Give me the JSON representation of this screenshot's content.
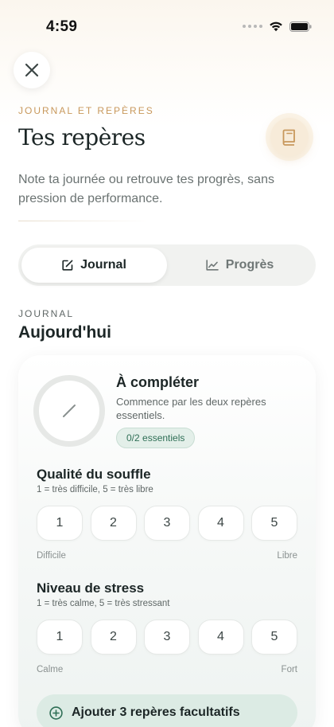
{
  "status_bar": {
    "time": "4:59"
  },
  "header": {
    "eyebrow": "JOURNAL ET REPÈRES",
    "title": "Tes repères",
    "subtitle": "Note ta journée ou retrouve tes progrès, sans pression de performance."
  },
  "tabs": [
    {
      "label": "Journal",
      "icon": "edit-square-icon",
      "active": true
    },
    {
      "label": "Progrès",
      "icon": "chart-line-icon",
      "active": false
    }
  ],
  "section": {
    "eyebrow": "JOURNAL",
    "title": "Aujourd'hui"
  },
  "status_card": {
    "title": "À compléter",
    "description": "Commence par les deux repères essentiels.",
    "badge": "0/2 essentiels",
    "progress": 0
  },
  "questions": [
    {
      "title": "Qualité du souffle",
      "hint": "1 = très difficile, 5 = très libre",
      "options": [
        "1",
        "2",
        "3",
        "4",
        "5"
      ],
      "low_label": "Difficile",
      "high_label": "Libre"
    },
    {
      "title": "Niveau de stress",
      "hint": "1 = très calme, 5 = très stressant",
      "options": [
        "1",
        "2",
        "3",
        "4",
        "5"
      ],
      "low_label": "Calme",
      "high_label": "Fort"
    }
  ],
  "add_button": {
    "label": "Ajouter 3 repères facultatifs"
  },
  "colors": {
    "accent_gold": "#c8985c",
    "accent_green": "#2f6f56",
    "text_dark": "#1c2626"
  }
}
